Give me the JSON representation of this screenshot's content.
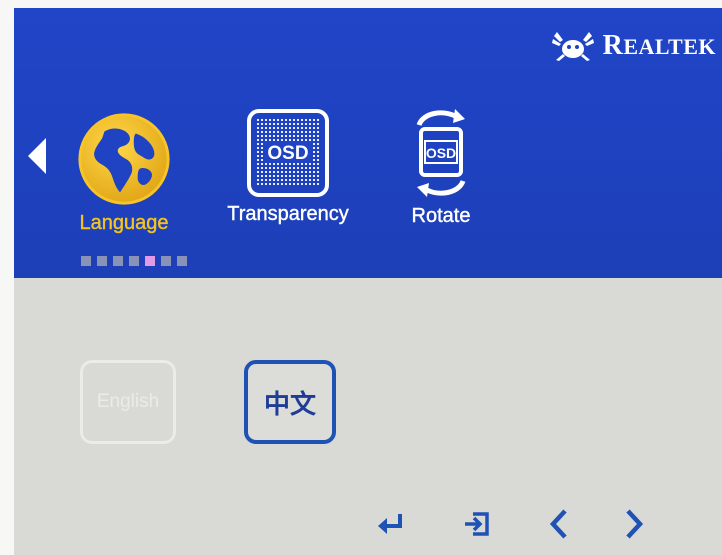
{
  "brand": {
    "name": "REALTEK",
    "name_first": "R",
    "name_rest": "EALTEK",
    "logo": "realtek-crab-logo"
  },
  "menu": {
    "items": [
      {
        "label": "Language",
        "icon": "globe-icon",
        "selected": true
      },
      {
        "label": "Transparency",
        "icon": "osd-transparency-icon",
        "selected": false
      },
      {
        "label": "Rotate",
        "icon": "osd-rotate-icon",
        "selected": false
      }
    ],
    "icon_text": "OSD",
    "pager": {
      "total": 7,
      "active": 5
    }
  },
  "options": [
    {
      "label": "English",
      "selected": false
    },
    {
      "label": "中文",
      "selected": true
    }
  ],
  "controls": [
    {
      "icon": "enter-icon"
    },
    {
      "icon": "exit-icon"
    },
    {
      "icon": "chevron-left-icon"
    },
    {
      "icon": "chevron-right-icon"
    }
  ],
  "colors": {
    "header_bg": "#1f43c2",
    "selected_label": "#f3c321",
    "body_bg": "#d9d9d6",
    "selected_border": "#1f52b5",
    "pager_active": "#e29ae8"
  }
}
